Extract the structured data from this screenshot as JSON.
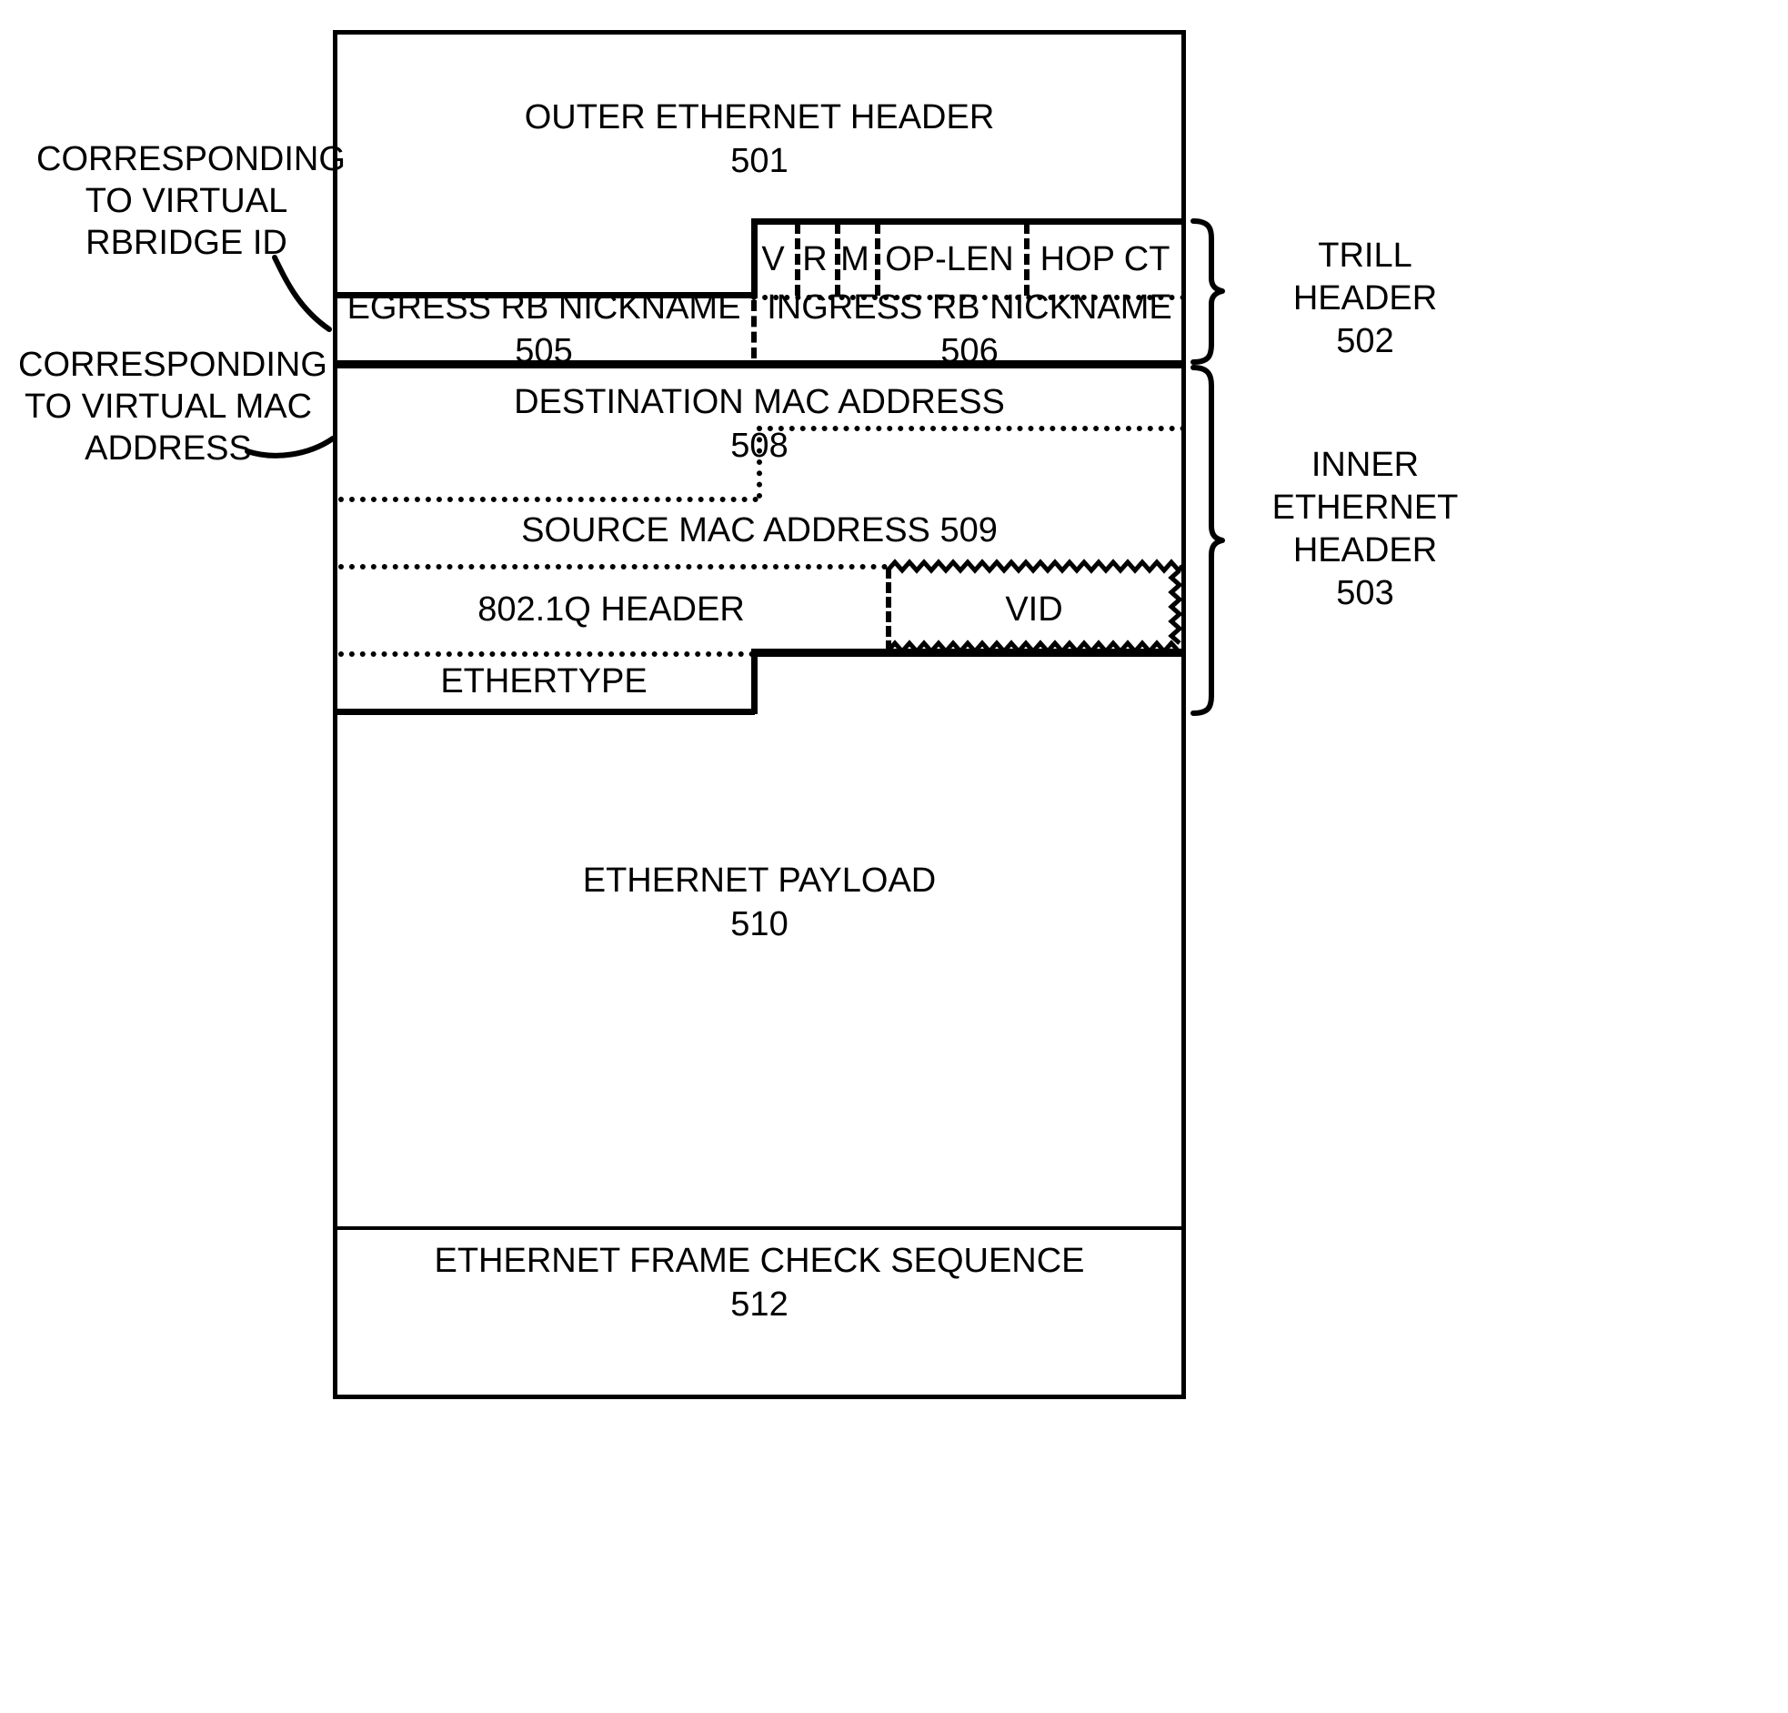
{
  "figure": {
    "type": "patent-packet-format-diagram",
    "description": "TRILL encapsulated Ethernet frame format"
  },
  "annotations": {
    "left_note_1": "CORRESPONDING\nTO VIRTUAL\nRBRIDGE ID",
    "left_note_2": "CORRESPONDING\nTO VIRTUAL MAC\nADDRESS"
  },
  "right_labels": {
    "trill_header": "TRILL\nHEADER\n502",
    "inner_ethernet_header": "INNER\nETHERNET\nHEADER\n503"
  },
  "fields": {
    "outer_ethernet_header": {
      "name": "OUTER ETHERNET HEADER",
      "ref": "501"
    },
    "trill_flags": {
      "v": "V",
      "r": "R",
      "m": "M",
      "op_len": "OP-LEN",
      "hop_ct": "HOP CT"
    },
    "egress_rb_nickname": "EGRESS RB NICKNAME 505",
    "ingress_rb_nickname": "INGRESS RB NICKNAME 506",
    "destination_mac_address": {
      "name": "DESTINATION MAC ADDRESS",
      "ref": "508"
    },
    "source_mac_address": "SOURCE MAC ADDRESS 509",
    "dot1q_header": "802.1Q HEADER",
    "vid": "VID",
    "ethertype": "ETHERTYPE",
    "ethernet_payload": {
      "name": "ETHERNET PAYLOAD",
      "ref": "510"
    },
    "ethernet_fcs": {
      "name": "ETHERNET FRAME CHECK SEQUENCE",
      "ref": "512"
    }
  },
  "colors": {
    "line": "#000000",
    "background": "#ffffff"
  }
}
